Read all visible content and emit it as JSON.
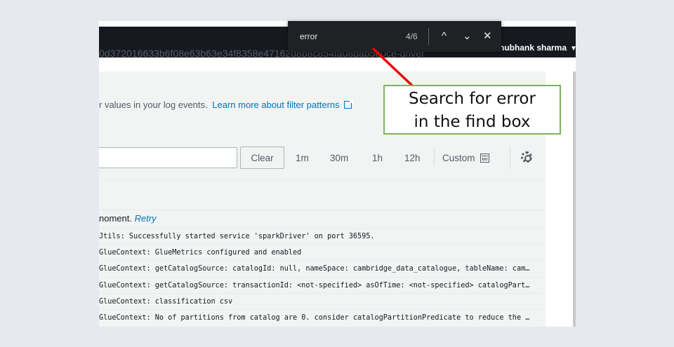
{
  "header": {
    "user_name": "hubhank sharma",
    "caret": "▼"
  },
  "log_stream_name": "0d372016633b6f08e63b63e34f8358e47162d8b8c854fa08bab5e0ce-driver",
  "filter_info": {
    "text": "r values in your log events.",
    "link_text": "Learn more about filter patterns"
  },
  "filter": {
    "input_value": "",
    "clear_label": "Clear",
    "time_options": [
      "1m",
      "30m",
      "1h",
      "12h"
    ],
    "custom_label": "Custom"
  },
  "logs": {
    "status_text": "noment.",
    "retry_label": "Retry",
    "rows": [
      "Jtils: Successfully started service 'sparkDriver' on port 36595.",
      "GlueContext: GlueMetrics configured and enabled",
      "GlueContext: getCatalogSource: catalogId: null, nameSpace: cambridge_data_catalogue, tableName: cam…",
      "GlueContext: getCatalogSource: transactionId: <not-specified> asOfTime: <not-specified> catalogPart…",
      "GlueContext: classification csv",
      "GlueContext: No of partitions from catalog are 0. consider catalogPartitionPredicate to reduce the …"
    ]
  },
  "find_bar": {
    "query": "error",
    "count": "4/6",
    "up_glyph": "^",
    "down_glyph": "⌄",
    "close_glyph": "✕"
  },
  "annotation": {
    "line1": "Search for error",
    "line2": "in the find box",
    "border_color": "#7fb356",
    "arrow_color": "#ee0000"
  },
  "colors": {
    "topbar": "#16191f",
    "link": "#0073bb",
    "findbar": "#202124"
  }
}
